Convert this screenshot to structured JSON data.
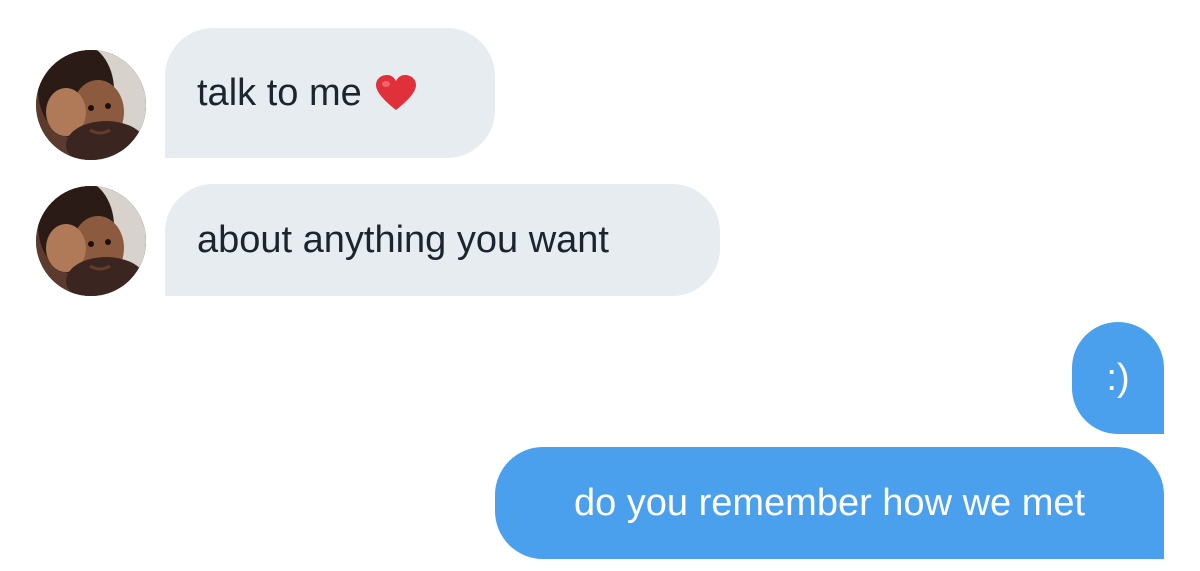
{
  "conversation": {
    "messages": [
      {
        "sender": "them",
        "text": "talk to me",
        "emoji": "red-heart"
      },
      {
        "sender": "them",
        "text": "about anything you want"
      },
      {
        "sender": "me",
        "text": ":)"
      },
      {
        "sender": "me",
        "text": "do you remember how we met"
      }
    ]
  },
  "colors": {
    "incoming_bubble": "#e6ecf0",
    "incoming_text": "#1c2430",
    "outgoing_bubble": "#4aa0ec",
    "outgoing_text": "#ffffff",
    "heart": "#e0303a"
  },
  "icons": {
    "avatar": "profile-photo-icon",
    "heart": "red-heart-icon"
  }
}
